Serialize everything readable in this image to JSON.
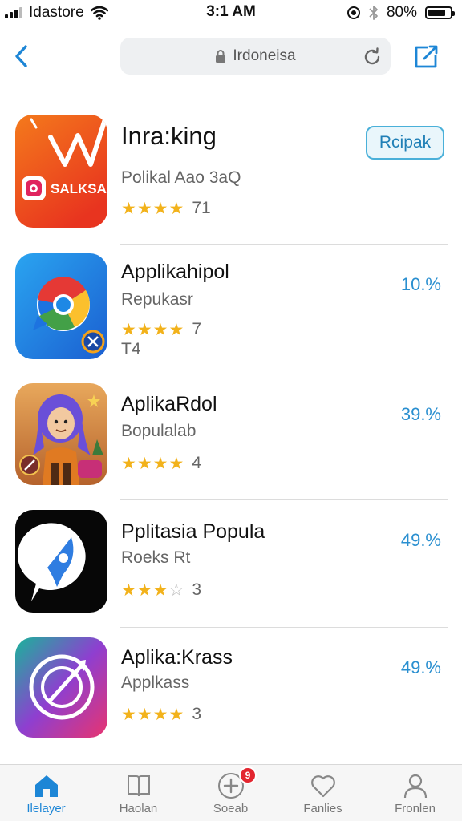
{
  "status_bar": {
    "carrier": "Idastore",
    "time": "3:1 AM",
    "battery_percent_text": "80%",
    "battery_level": 0.8
  },
  "nav": {
    "url": "Irdoneisa"
  },
  "apps": [
    {
      "name": "Inra:king",
      "subtitle": "Polikal Aao 3aQ",
      "stars_filled": 4,
      "stars_total": 4,
      "rating_count": "71",
      "action_label": "Rcipak",
      "icon_text": "SALKSA",
      "icon_name": "salksa-app-icon"
    },
    {
      "name": "Applikahipol",
      "subtitle": "Repukasr",
      "stars_filled": 4,
      "stars_total": 4,
      "rating_count": "7",
      "extra": "T4",
      "percent": "10.%",
      "icon_name": "chrome-like-app-icon"
    },
    {
      "name": "AplikaRdol",
      "subtitle": "Bopulalab",
      "stars_filled": 4,
      "stars_total": 4,
      "rating_count": "4",
      "percent": "39.%",
      "icon_name": "character-app-icon"
    },
    {
      "name": "Pplitasia Popula",
      "subtitle": "Roeks Rt",
      "stars_filled": 3,
      "stars_total": 4,
      "rating_count": "3",
      "percent": "49.%",
      "icon_name": "messenger-app-icon"
    },
    {
      "name": "Aplika:Krass",
      "subtitle": "Applkass",
      "stars_filled": 4,
      "stars_total": 4,
      "rating_count": "3",
      "percent": "49.%",
      "icon_name": "compass-app-icon"
    }
  ],
  "tabs": [
    {
      "label": "Ilelayer",
      "icon": "home-icon",
      "active": true
    },
    {
      "label": "Haolan",
      "icon": "book-icon",
      "active": false
    },
    {
      "label": "Soeab",
      "icon": "plus-circle-icon",
      "active": false,
      "badge": "9"
    },
    {
      "label": "Fanlies",
      "icon": "heart-icon",
      "active": false
    },
    {
      "label": "Fronlen",
      "icon": "person-icon",
      "active": false
    }
  ],
  "colors": {
    "accent": "#1d86d6",
    "percent_text": "#2a8fd0",
    "star": "#f2b21b",
    "badge": "#e32630"
  }
}
